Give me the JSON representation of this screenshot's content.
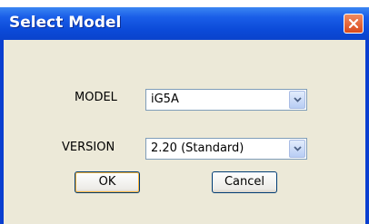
{
  "window": {
    "title": "Select Model"
  },
  "form": {
    "model_label": "MODEL",
    "model_value": "iG5A",
    "version_label": "VERSION",
    "version_value": "2.20 (Standard)"
  },
  "buttons": {
    "ok_label": "OK",
    "cancel_label": "Cancel"
  },
  "icons": {
    "close": "close-icon",
    "dropdown": "chevron-down-icon"
  },
  "colors": {
    "titlebar": "#0b4ad8",
    "client": "#ece9d8",
    "close": "#d94a1c"
  }
}
